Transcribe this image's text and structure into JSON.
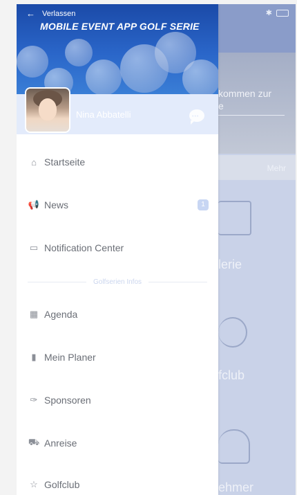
{
  "background_app": {
    "welcome_text": "kommen zur\ne",
    "mehr": "Mehr",
    "labels": [
      "lerie",
      "fclub",
      "ehmer"
    ]
  },
  "drawer": {
    "back_label": "Verlassen",
    "app_title": "MOBILE EVENT APP GOLF SERIE",
    "profile": {
      "name": "Nina Abbatelli"
    },
    "menu": [
      {
        "label": "Startseite",
        "icon": "home-icon"
      },
      {
        "label": "News",
        "icon": "megaphone-icon",
        "badge": "1"
      },
      {
        "label": "Notification Center",
        "icon": "inbox-icon"
      }
    ],
    "section_title": "Golfserien Infos",
    "menu2": [
      {
        "label": "Agenda",
        "icon": "calendar-icon"
      },
      {
        "label": "Mein Planer",
        "icon": "book-icon"
      },
      {
        "label": "Sponsoren",
        "icon": "pin-icon"
      },
      {
        "label": "Anreise",
        "icon": "train-icon"
      },
      {
        "label": "Golfclub",
        "icon": "star-icon"
      }
    ]
  },
  "colors": {
    "header_blue": "#1b4aa8",
    "profile_bg": "#e3ebfb",
    "badge": "#c8d6f3"
  }
}
